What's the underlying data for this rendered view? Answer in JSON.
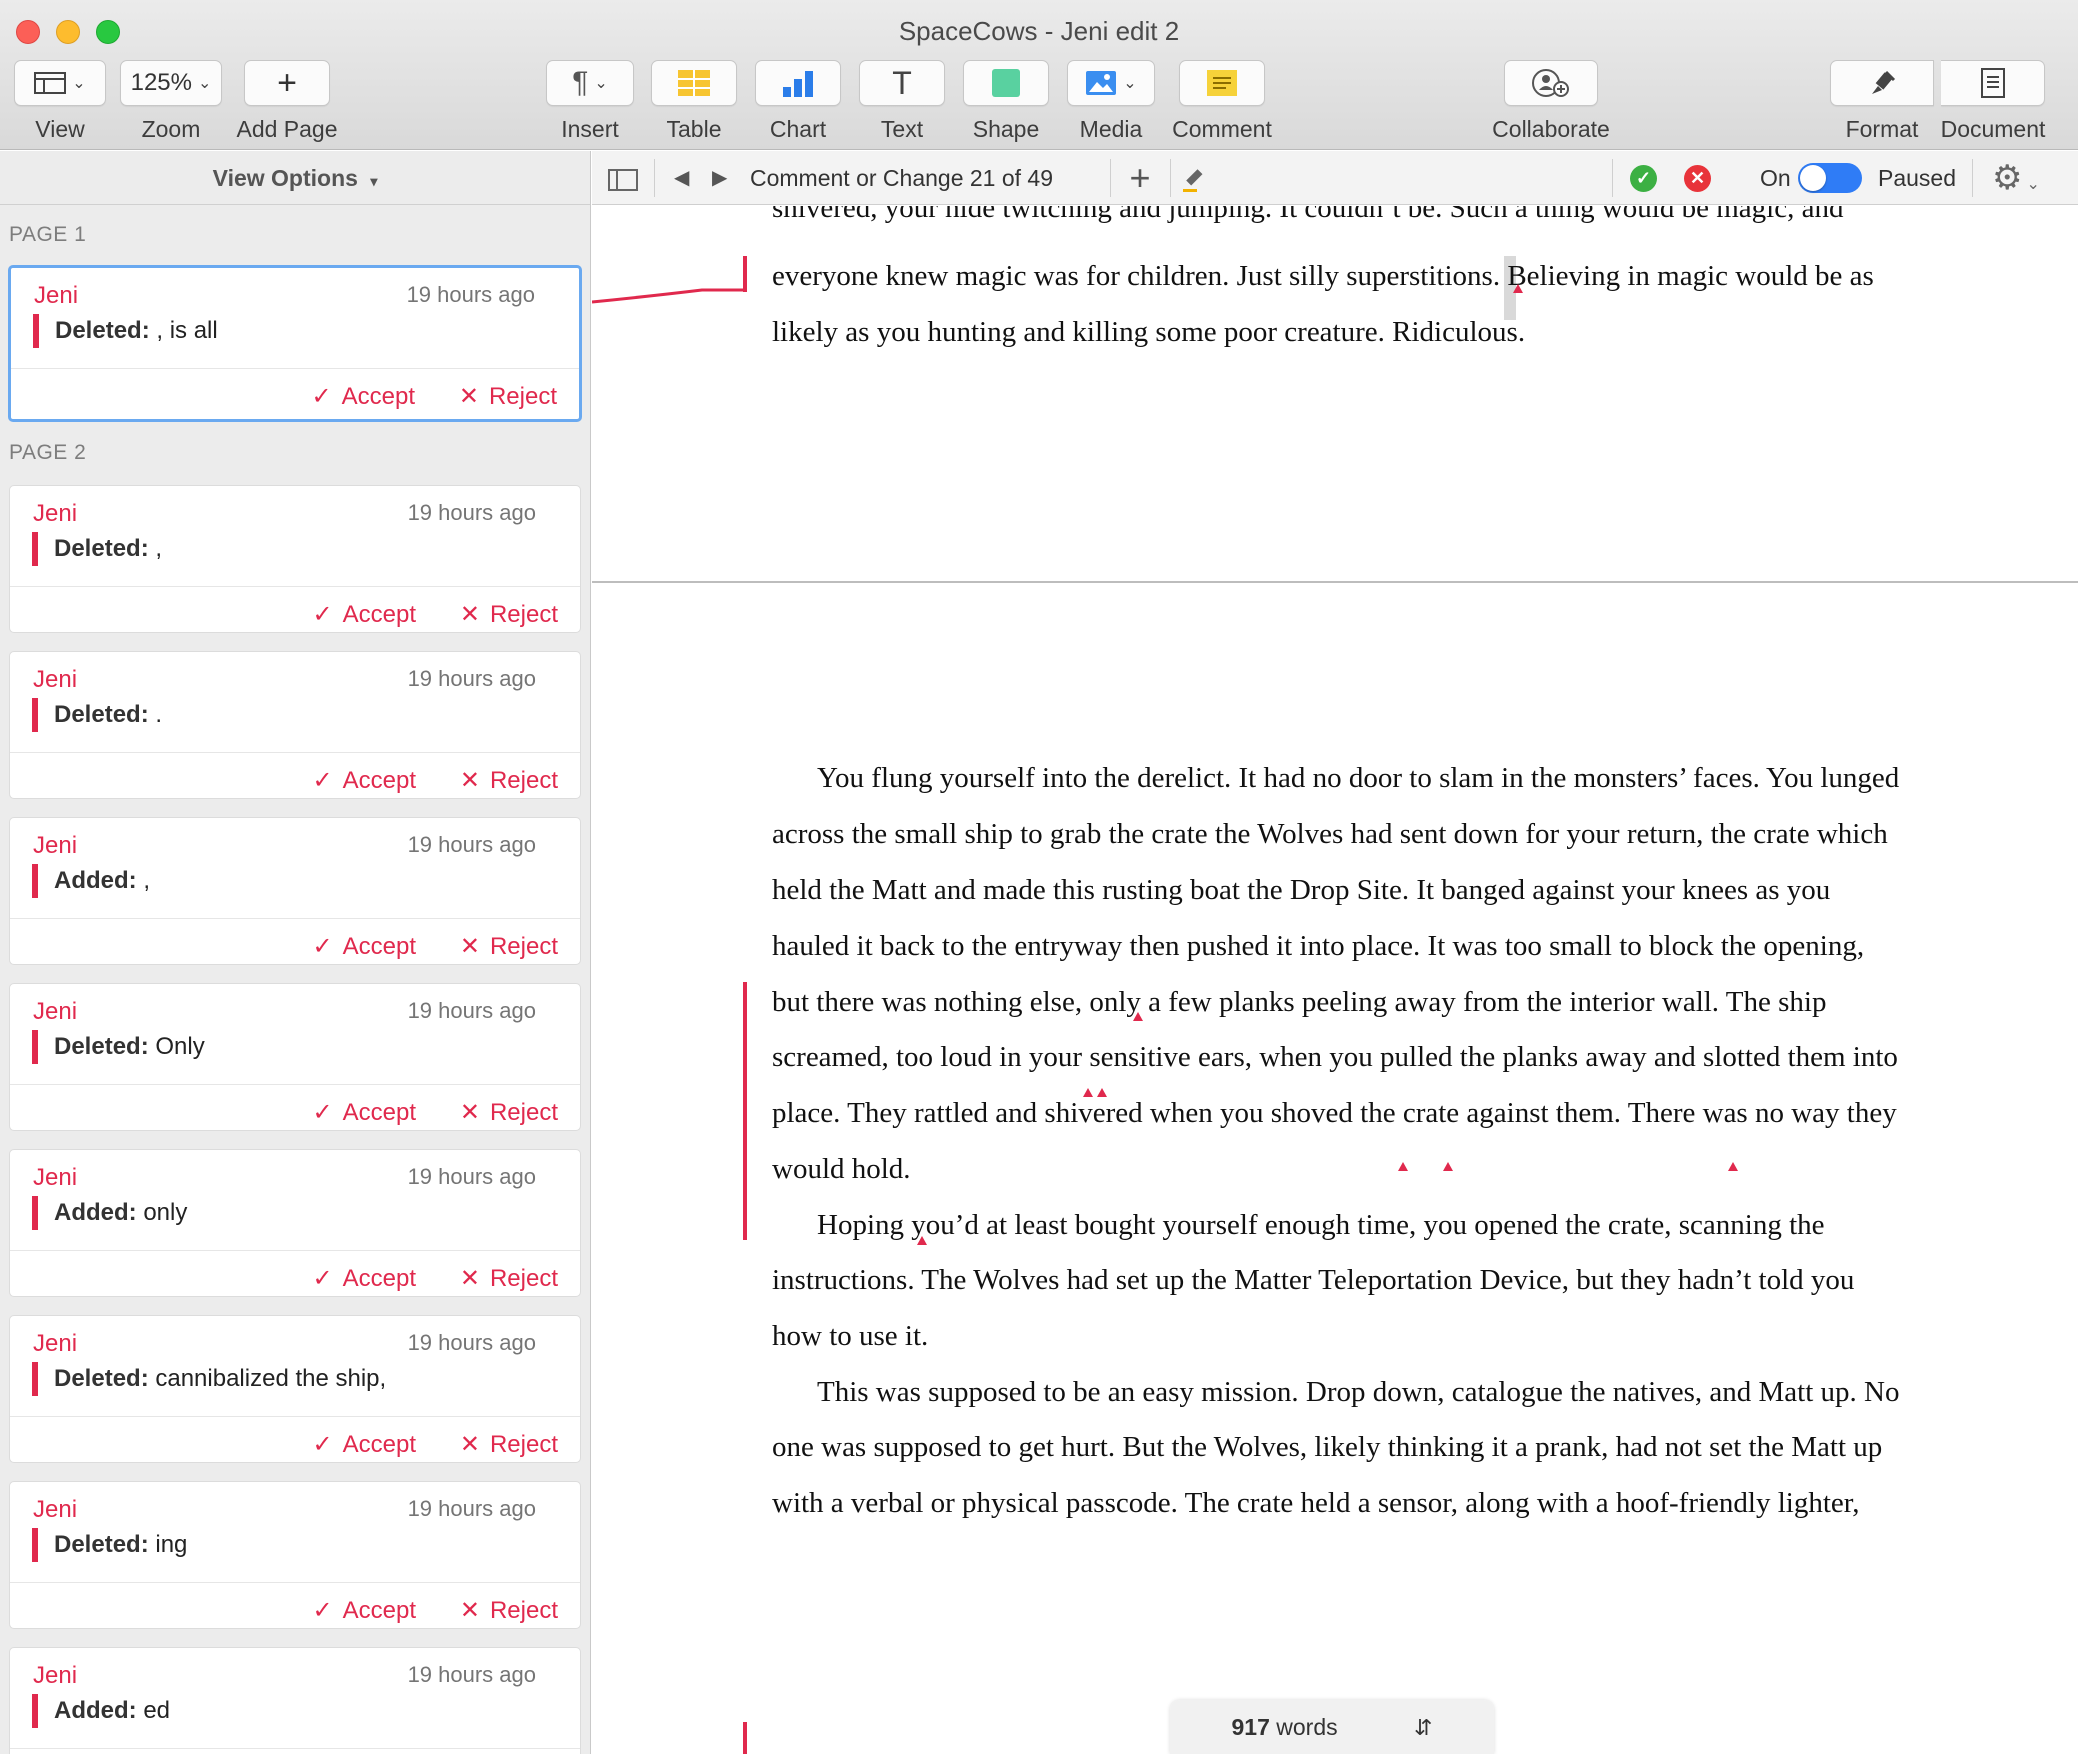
{
  "window": {
    "title": "SpaceCows - Jeni edit 2"
  },
  "toolbar": {
    "view": "View",
    "zoom_value": "125%",
    "zoom": "Zoom",
    "add_page": "Add Page",
    "insert": "Insert",
    "table": "Table",
    "chart": "Chart",
    "text": "Text",
    "shape": "Shape",
    "media": "Media",
    "comment": "Comment",
    "collaborate": "Collaborate",
    "format": "Format",
    "document": "Document"
  },
  "sidebar": {
    "view_options": "View Options",
    "page1_label": "PAGE 1",
    "page2_label": "PAGE 2",
    "cards": [
      {
        "author": "Jeni",
        "time": "19 hours ago",
        "kind": "Deleted:",
        "text": ", is all",
        "accept": "Accept",
        "reject": "Reject"
      },
      {
        "author": "Jeni",
        "time": "19 hours ago",
        "kind": "Deleted:",
        "text": ",",
        "accept": "Accept",
        "reject": "Reject"
      },
      {
        "author": "Jeni",
        "time": "19 hours ago",
        "kind": "Deleted:",
        "text": ".",
        "accept": "Accept",
        "reject": "Reject"
      },
      {
        "author": "Jeni",
        "time": "19 hours ago",
        "kind": "Added:",
        "text": ",",
        "accept": "Accept",
        "reject": "Reject"
      },
      {
        "author": "Jeni",
        "time": "19 hours ago",
        "kind": "Deleted:",
        "text": "Only",
        "accept": "Accept",
        "reject": "Reject"
      },
      {
        "author": "Jeni",
        "time": "19 hours ago",
        "kind": "Added:",
        "text": "only",
        "accept": "Accept",
        "reject": "Reject"
      },
      {
        "author": "Jeni",
        "time": "19 hours ago",
        "kind": "Deleted:",
        "text": "cannibalized the ship,",
        "accept": "Accept",
        "reject": "Reject"
      },
      {
        "author": "Jeni",
        "time": "19 hours ago",
        "kind": "Deleted:",
        "text": "ing",
        "accept": "Accept",
        "reject": "Reject"
      },
      {
        "author": "Jeni",
        "time": "19 hours ago",
        "kind": "Added:",
        "text": "ed",
        "accept": "Accept",
        "reject": "Reject"
      }
    ]
  },
  "review_bar": {
    "status": "Comment or Change 21 of 49",
    "tracking_label": "On",
    "paused_label": "Paused"
  },
  "document": {
    "lines": [
      "shivered, your hide twitching and jumping. It couldn’t be. Such a thing would be magic, and",
      "everyone knew magic was for children. Just silly superstitions. Believing in magic would be as",
      "likely as you hunting and killing some poor creature. Ridiculous.",
      "You flung yourself into the derelict. It had no door to slam in the monsters’ faces. You lunged",
      "across the small ship to grab the crate the Wolves had sent down for your return, the crate which",
      "held the Matt and made this rusting boat the Drop Site. It banged against your knees as you",
      "hauled it back to the entryway then pushed it into place. It was too small to block the opening,",
      "but there was nothing else, only a few planks peeling away from the interior wall. The ship",
      "screamed, too loud in your sensitive ears, when you pulled the planks away and slotted them into",
      "place. They rattled and shivered when you shoved the crate against them. There was no way they",
      "would hold.",
      "Hoping you’d at least bought yourself enough time, you opened the crate, scanning the",
      "instructions. The Wolves had set up the Matter Teleportation Device, but they hadn’t told you",
      "how to use it.",
      "This was supposed to be an easy mission. Drop down, catalogue the natives, and Matt up. No",
      "one was supposed to get hurt. But the Wolves, likely thinking it a prank, had not set the Matt up",
      "with a verbal or physical passcode. The crate held a sensor, along with a hoof-friendly lighter,"
    ],
    "word_count_number": "917",
    "word_count_unit": "words"
  },
  "colors": {
    "accent": "#e0294d",
    "selection": "#6aa9f0",
    "toggle": "#2f7cf6"
  }
}
